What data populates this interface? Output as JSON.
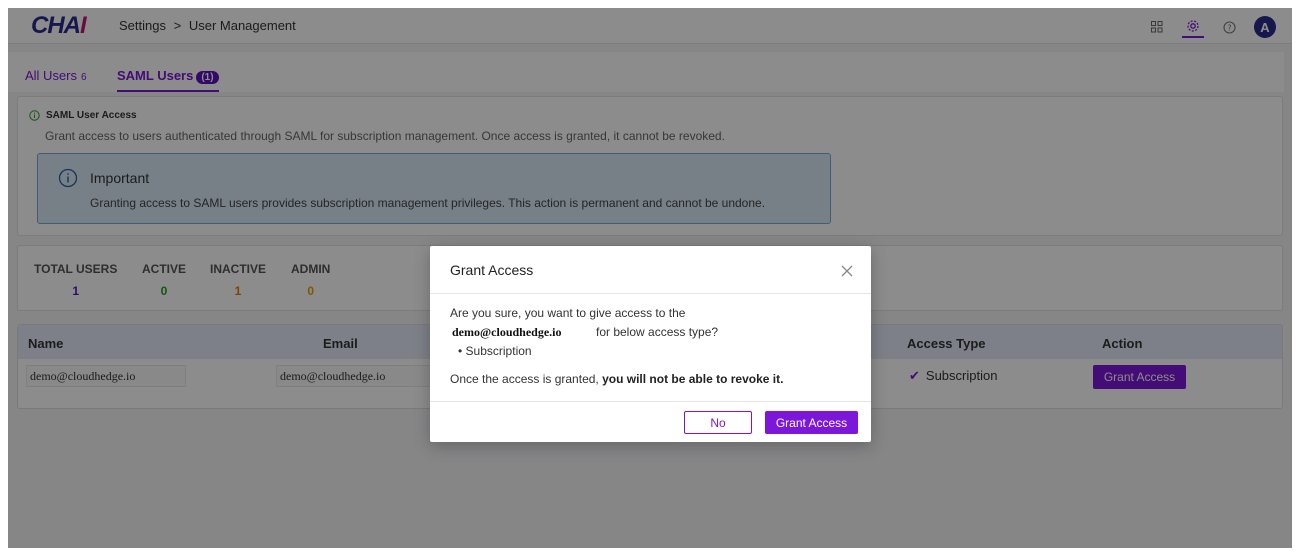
{
  "header": {
    "logo_text": "CHA",
    "logo_accent": "I",
    "breadcrumb_parent": "Settings",
    "breadcrumb_sep": ">",
    "breadcrumb_current": "User Management",
    "avatar_letter": "A",
    "icons": [
      "grid-icon",
      "settings-gear-icon",
      "help-icon"
    ]
  },
  "tabs": {
    "all_users_label": "All Users",
    "all_users_count": "6",
    "saml_users_label": "SAML Users",
    "saml_users_count": "(1)"
  },
  "info": {
    "title": "SAML User Access",
    "description": "Grant access to users authenticated through SAML for subscription management. Once access is granted, it cannot be revoked.",
    "important_title": "Important",
    "important_desc": "Granting access to SAML users provides subscription management privileges. This action is permanent and cannot be undone."
  },
  "stats": {
    "total_label": "TOTAL USERS",
    "total_value": "1",
    "active_label": "ACTIVE",
    "active_value": "0",
    "inactive_label": "INACTIVE",
    "inactive_value": "1",
    "admin_label": "ADMIN",
    "admin_value": "0"
  },
  "table": {
    "headers": {
      "name": "Name",
      "email": "Email",
      "access_type": "Access Type",
      "action": "Action"
    },
    "row": {
      "name": "demo@cloudhedge.io",
      "email": "demo@cloudhedge.io",
      "access_type": "Subscription",
      "action_label": "Grant Access"
    }
  },
  "modal": {
    "title": "Grant Access",
    "line1": "Are you sure, you want to give access to the",
    "email": "demo@cloudhedge.io",
    "line2": "for below access type?",
    "bullet": "Subscription",
    "line3_prefix": "Once the access is granted,",
    "line3_bold": "you will not be able to revoke it.",
    "no_label": "No",
    "grant_label": "Grant Access"
  },
  "colors": {
    "accent": "#7c16d8",
    "logo": "#2b2a8e",
    "info_box": "#dbe9f6"
  }
}
